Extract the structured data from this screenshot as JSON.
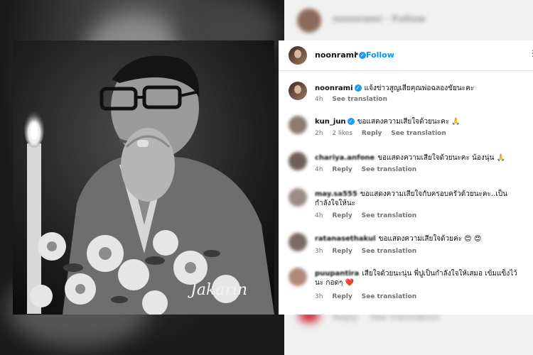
{
  "post_author": {
    "username": "noonrami",
    "verified": true,
    "follow_label": "Follow",
    "separator": "•",
    "more_icon": "more-icon"
  },
  "watermark": "Jakarin",
  "caption": {
    "username": "noonrami",
    "text": "แจ้งข่าวสูญเสียคุณพ่อฉลองขัยนะคะ",
    "time": "4h",
    "see_translation": "See translation"
  },
  "comments": [
    {
      "username": "kun_jun",
      "verified": true,
      "text": "ขอแสดงความเสียใจด้วยนะคะ 🙏",
      "time": "2h",
      "likes": "2 likes",
      "reply": "Reply",
      "see_translation": "See translation",
      "avatar_color": "#8d7a70"
    },
    {
      "username": "chariya.anfone",
      "verified": false,
      "text": "ขอแสดงความเสียใจด้วยนะคะ น้องนุ่น 🙏",
      "time": "4h",
      "likes": "",
      "reply": "Reply",
      "see_translation": "See translation",
      "avatar_color": "#6f5f5a"
    },
    {
      "username": "may.sa555",
      "verified": false,
      "text": "ขอแสดงความเสียใจกับครอบครัวด้วยนะคะ..เป็นกำลังใจให้นะ",
      "time": "4h",
      "likes": "",
      "reply": "Reply",
      "see_translation": "See translation",
      "avatar_color": "#9c8b86"
    },
    {
      "username": "ratanasethakul",
      "verified": false,
      "text": "ขอแสดงความเสียใจด้วยค่ะ 😍 😍",
      "time": "3h",
      "likes": "",
      "reply": "Reply",
      "see_translation": "See translation",
      "avatar_color": "#7a6a62"
    },
    {
      "username": "puupantira",
      "verified": false,
      "text": "เสียใจด้วยนะนุ่น พี่ปูเป็นกำลังใจให้เสมอ เข้มแข็งไว้นะ กอดๆ ❤️",
      "time": "3h",
      "likes": "",
      "reply": "Reply",
      "see_translation": "See translation",
      "avatar_color": "#b08a78"
    }
  ],
  "colors": {
    "accent": "#0095f6",
    "verified": "#1d9bf0",
    "meta": "#737373"
  }
}
